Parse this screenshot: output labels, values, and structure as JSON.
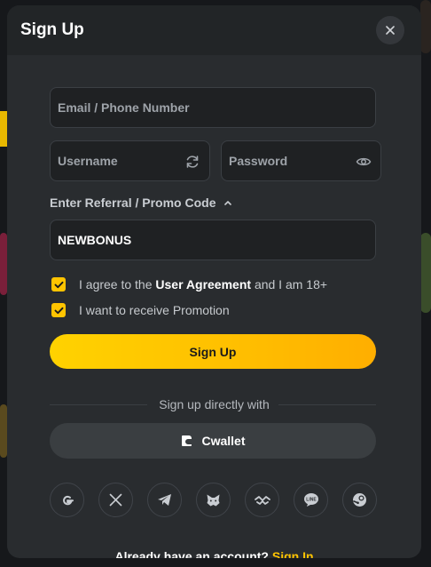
{
  "modal": {
    "title": "Sign Up",
    "close_icon": "close-icon"
  },
  "form": {
    "email_placeholder": "Email / Phone Number",
    "username_placeholder": "Username",
    "password_placeholder": "Password",
    "promo_toggle_label": "Enter Referral / Promo Code",
    "promo_value": "NEWBONUS",
    "agree_prefix": "I agree to the",
    "agree_link": "User Agreement",
    "agree_suffix": "and I am 18+",
    "promotion_label": "I want to receive Promotion",
    "agree_checked": true,
    "promotion_checked": true,
    "submit_label": "Sign Up"
  },
  "social": {
    "divider_text": "Sign up directly with",
    "wallet_label": "Cwallet",
    "providers": [
      "google-icon",
      "x-icon",
      "telegram-icon",
      "metamask-icon",
      "walletconnect-icon",
      "line-icon",
      "steam-icon"
    ]
  },
  "footer": {
    "prompt": "Already have an account?",
    "signin_label": "Sign In"
  },
  "colors": {
    "accent": "#ffc400",
    "modal_bg": "#292c2f",
    "header_bg": "#222527"
  }
}
